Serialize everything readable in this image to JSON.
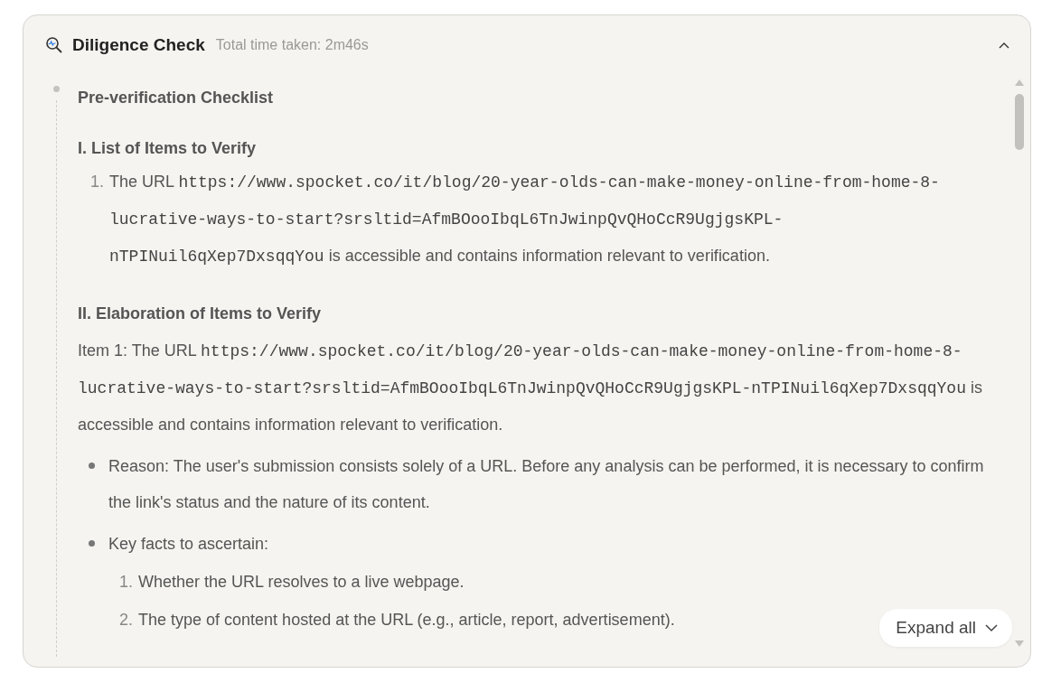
{
  "header": {
    "title": "Diligence Check",
    "subtitle": "Total time taken: 2m46s",
    "expanded": true
  },
  "timeline": {
    "heading": "Pre-verification Checklist"
  },
  "sections": [
    {
      "kind": "heading",
      "text": "I. List of Items to Verify"
    },
    {
      "kind": "numbered",
      "items": [
        {
          "marker": "1.",
          "segments": [
            {
              "kind": "text",
              "text": "The URL "
            },
            {
              "kind": "code",
              "text": "https://www.spocket.co/it/blog/20-year-olds-can-make-money-online-from-home-8-lucrative-ways-to-start?srsltid=AfmBOooIbqL6TnJwinpQvQHoCcR9UgjgsKPL-nTPINuil6qXep7DxsqqYou"
            },
            {
              "kind": "text",
              "text": " is accessible and contains information relevant to verification."
            }
          ]
        }
      ]
    },
    {
      "kind": "heading",
      "text": "II. Elaboration of Items to Verify"
    },
    {
      "kind": "paragraph",
      "segments": [
        {
          "kind": "text",
          "text": "Item 1: The URL "
        },
        {
          "kind": "code",
          "text": "https://www.spocket.co/it/blog/20-year-olds-can-make-money-online-from-home-8-lucrative-ways-to-start?srsltid=AfmBOooIbqL6TnJwinpQvQHoCcR9UgjgsKPL-nTPINuil6qXep7DxsqqYou"
        },
        {
          "kind": "text",
          "text": " is accessible and contains information relevant to verification."
        }
      ]
    },
    {
      "kind": "bullets",
      "items": [
        {
          "text": "Reason: The user's submission consists solely of a URL. Before any analysis can be performed, it is necessary to confirm the link's status and the nature of its content."
        },
        {
          "text": "Key facts to ascertain:",
          "children": [
            {
              "marker": "1.",
              "text": "Whether the URL resolves to a live webpage."
            },
            {
              "marker": "2.",
              "text": "The type of content hosted at the URL (e.g., article, report, advertisement)."
            }
          ]
        }
      ]
    }
  ],
  "expand_button": {
    "label": "Expand all"
  }
}
